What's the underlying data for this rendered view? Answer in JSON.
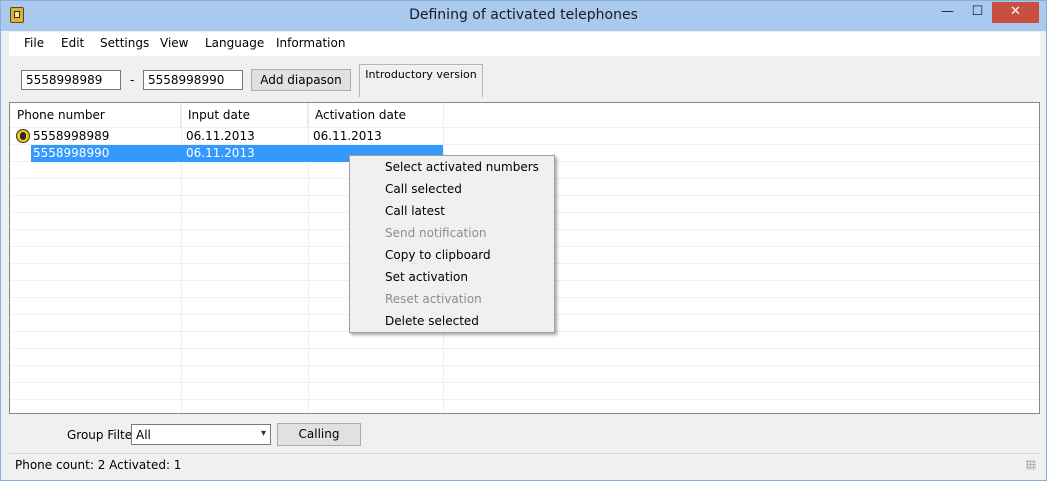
{
  "window": {
    "title": "Defining of activated telephones",
    "controls": {
      "minimize": "—",
      "maximize": "☐",
      "close": "✕"
    }
  },
  "menu": [
    "File",
    "Edit",
    "Settings",
    "View",
    "Language",
    "Information"
  ],
  "toolbar": {
    "range_from": "5558998989",
    "range_separator": "-",
    "range_to": "5558998990",
    "add_button": "Add diapason",
    "version_label": "Introductory version"
  },
  "table": {
    "columns": [
      "Phone number",
      "Input date",
      "Activation date"
    ],
    "rows": [
      {
        "phone": "5558998989",
        "input_date": "06.11.2013",
        "activation_date": "06.11.2013",
        "activated": true
      },
      {
        "phone": "5558998990",
        "input_date": "06.11.2013",
        "activation_date": "",
        "activated": false,
        "selected": true
      }
    ]
  },
  "context_menu": {
    "items": [
      {
        "label": "Select activated numbers",
        "enabled": true
      },
      {
        "label": "Call selected",
        "enabled": true
      },
      {
        "label": "Call latest",
        "enabled": true
      },
      {
        "label": "Send notification",
        "enabled": false
      },
      {
        "label": "Copy to clipboard",
        "enabled": true
      },
      {
        "label": "Set activation",
        "enabled": true
      },
      {
        "label": "Reset activation",
        "enabled": false
      },
      {
        "label": "Delete selected",
        "enabled": true
      }
    ]
  },
  "footer": {
    "group_filter_label": "Group Filter:",
    "group_filter_value": "All",
    "calling_button": "Calling"
  },
  "status": {
    "text": "Phone count: 2  Activated: 1"
  },
  "colors": {
    "title_bar": "#a9c9ee",
    "selection": "#3399ff",
    "close_button": "#c7503e",
    "disabled_text": "#8d8d8d"
  }
}
